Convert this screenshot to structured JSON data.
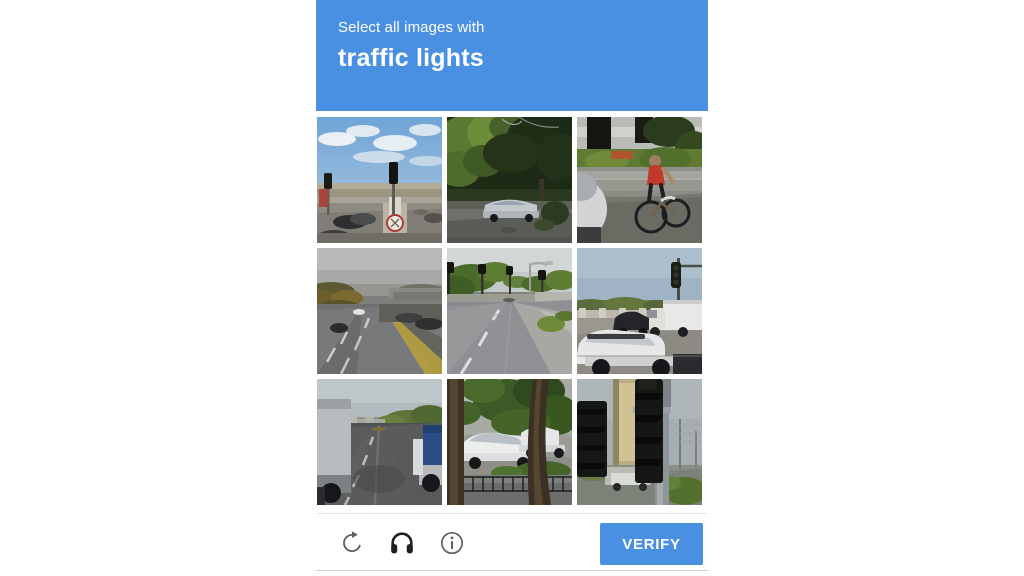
{
  "dialog": {
    "header": {
      "prompt": "Select all images with",
      "target": "traffic lights",
      "background_color": "#4a90e2",
      "text_color": "#ffffff"
    },
    "grid": {
      "rows": 3,
      "columns": 3,
      "tiles": [
        {
          "index": 1,
          "position": "row1-col1",
          "description": "Wide desert intersection with traffic signals, cars crossing, blue sky with white clouds",
          "contains_target": true,
          "selected": false
        },
        {
          "index": 2,
          "position": "row1-col2",
          "description": "Tree-lined suburban street with a silver sedan parked beneath dense green foliage",
          "contains_target": false,
          "selected": false
        },
        {
          "index": 3,
          "position": "row1-col3",
          "description": "Cyclist in a red top riding along a sidewalk past a parked car and green lawn",
          "contains_target": false,
          "selected": false
        },
        {
          "index": 4,
          "position": "row2-col1",
          "description": "Divided highway with yellow center line, distant cars and autumn roadside trees",
          "contains_target": false,
          "selected": false
        },
        {
          "index": 5,
          "position": "row2-col2",
          "description": "Empty multi-lane boulevard approaching an intersection with traffic signals and a street lamp",
          "contains_target": true,
          "selected": false
        },
        {
          "index": 6,
          "position": "row2-col3",
          "description": "Overhead traffic light on a mast arm above an intersection with a white box truck and SUVs",
          "contains_target": true,
          "selected": false
        },
        {
          "index": 7,
          "position": "row3-col1",
          "description": "View down a road between two semi-trailer trucks, overcast sky",
          "contains_target": false,
          "selected": false
        },
        {
          "index": 8,
          "position": "row3-col2",
          "description": "White pickup trucks parked behind an iron fence framed by two tree trunks",
          "contains_target": false,
          "selected": false
        },
        {
          "index": 9,
          "position": "row3-col3",
          "description": "Close-up of tall traffic signal heads on a pole against a pale sky",
          "contains_target": true,
          "selected": false
        }
      ]
    },
    "footer": {
      "icons": [
        {
          "name": "reload-icon",
          "label": "Get a new challenge"
        },
        {
          "name": "audio-icon",
          "label": "Get an audio challenge"
        },
        {
          "name": "info-icon",
          "label": "Help"
        }
      ],
      "verify_label": "VERIFY",
      "verify_color": "#4a90e2"
    }
  }
}
